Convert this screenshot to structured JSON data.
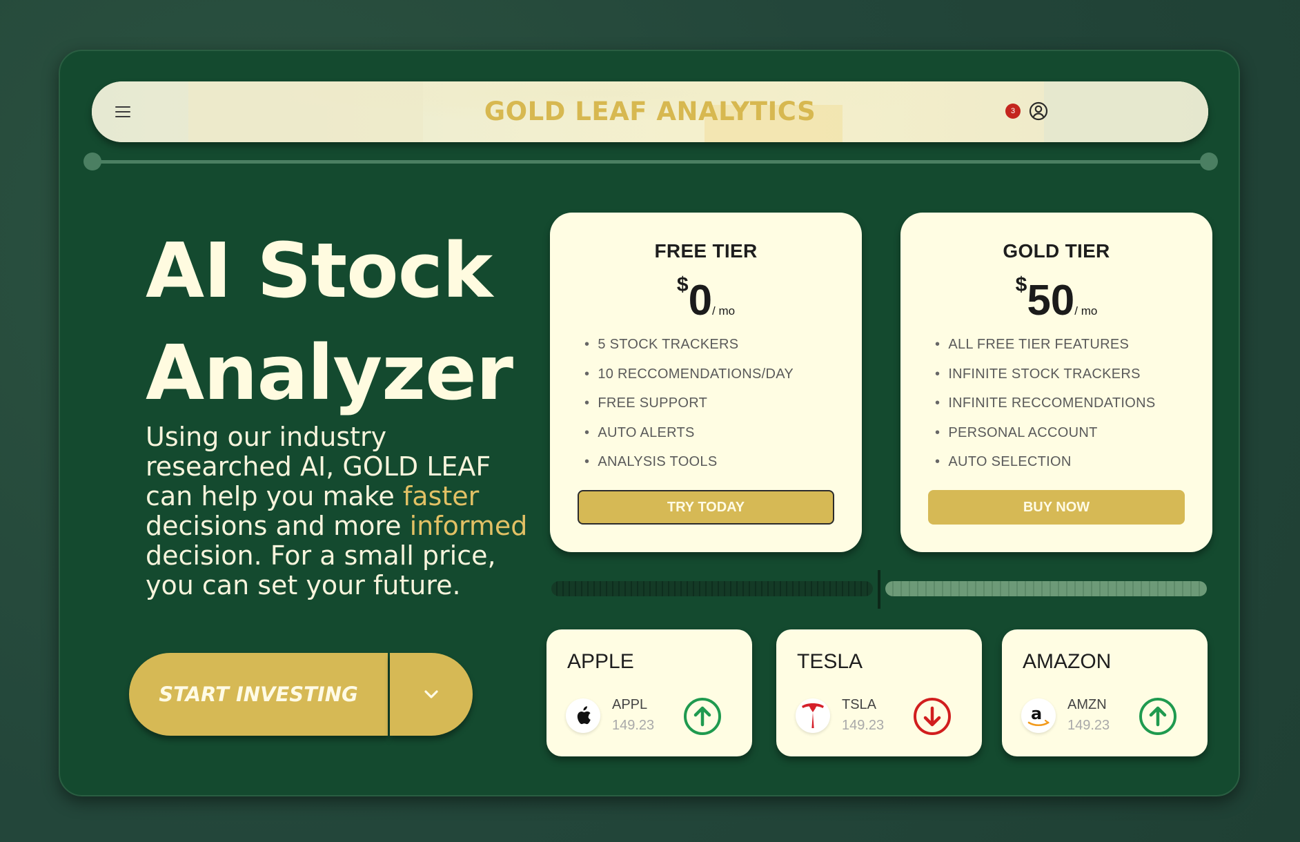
{
  "header": {
    "brand": "GOLD LEAF ANALYTICS",
    "notification_count": "3",
    "icons": {
      "menu": "menu-icon",
      "user": "user-circle-icon"
    }
  },
  "hero": {
    "title_line1": "AI Stock",
    "title_line2": "Analyzer",
    "desc_part1": "Using our industry researched AI, GOLD LEAF can help you make ",
    "desc_highlight1": "faster",
    "desc_part2": " decisions and more ",
    "desc_highlight2": "informed",
    "desc_part3": " decision. For a small price, you can set your future.",
    "cta_label": "START INVESTING",
    "cta_dropdown_icon": "chevron-down-icon"
  },
  "tiers": [
    {
      "name": "FREE TIER",
      "currency": "$",
      "price": "0",
      "period": "/ mo",
      "features": [
        "5 STOCK TRACKERS",
        "10 RECCOMENDATIONS/DAY",
        "FREE SUPPORT",
        "AUTO ALERTS",
        "ANALYSIS TOOLS"
      ],
      "button": "TRY TODAY"
    },
    {
      "name": "GOLD TIER",
      "currency": "$",
      "price": "50",
      "period": "/ mo",
      "features": [
        "ALL FREE TIER FEATURES",
        "INFINITE STOCK TRACKERS",
        "INFINITE RECCOMENDATIONS",
        "PERSONAL ACCOUNT",
        "AUTO SELECTION"
      ],
      "button": "BUY NOW"
    }
  ],
  "progress": {
    "fraction": 0.5
  },
  "stocks": [
    {
      "name": "APPLE",
      "symbol": "APPL",
      "price": "149.23",
      "trend": "up",
      "logo": "apple-logo-icon"
    },
    {
      "name": "TESLA",
      "symbol": "TSLA",
      "price": "149.23",
      "trend": "down",
      "logo": "tesla-logo-icon"
    },
    {
      "name": "AMAZON",
      "symbol": "AMZN",
      "price": "149.23",
      "trend": "up",
      "logo": "amazon-logo-icon"
    }
  ],
  "colors": {
    "frame_green": "#144a2f",
    "gold": "#d6b955",
    "cream": "#fffde3",
    "up_green": "#1f9a4f",
    "down_red": "#d11e1e"
  }
}
